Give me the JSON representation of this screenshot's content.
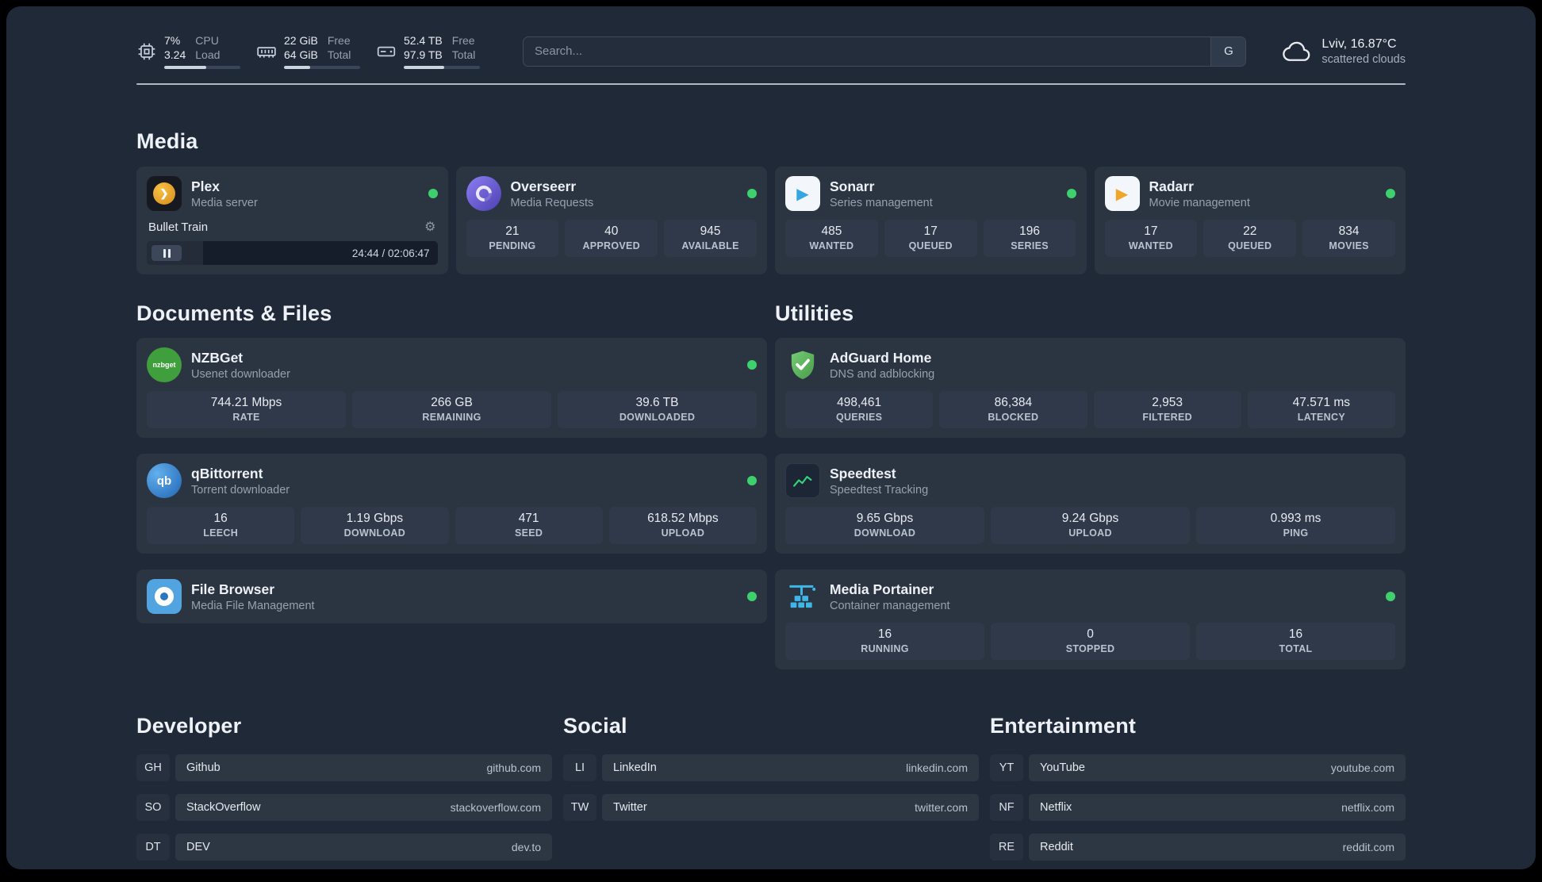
{
  "topbar": {
    "cpu": {
      "v1": "7%",
      "v2": "3.24",
      "l1": "CPU",
      "l2": "Load",
      "bar_percent": 55
    },
    "ram": {
      "v1": "22 GiB",
      "v2": "64 GiB",
      "l1": "Free",
      "l2": "Total",
      "bar_percent": 34
    },
    "disk": {
      "v1": "52.4 TB",
      "v2": "97.9 TB",
      "l1": "Free",
      "l2": "Total",
      "bar_percent": 53
    },
    "search": {
      "placeholder": "Search...",
      "button_label": "G"
    },
    "weather": {
      "location": "Lviv, 16.87°C",
      "condition": "scattered clouds"
    }
  },
  "icons": {
    "gear": "⚙",
    "plex_chevron": "❯",
    "sonarr_play": "▶",
    "radarr_play": "▶",
    "qbittorrent_label": "qb",
    "nzbget_label": "nzbget"
  },
  "sections": {
    "media": {
      "title": "Media"
    },
    "documents": {
      "title": "Documents & Files"
    },
    "utilities": {
      "title": "Utilities"
    },
    "developer": {
      "title": "Developer"
    },
    "social": {
      "title": "Social"
    },
    "entertainment": {
      "title": "Entertainment"
    }
  },
  "apps": {
    "plex": {
      "name": "Plex",
      "subtitle": "Media server",
      "player": {
        "track": "Bullet Train",
        "time": "24:44 / 02:06:47",
        "progress_percent": 19.5
      }
    },
    "overseerr": {
      "name": "Overseerr",
      "subtitle": "Media Requests",
      "stats": [
        {
          "value": "21",
          "label": "PENDING"
        },
        {
          "value": "40",
          "label": "APPROVED"
        },
        {
          "value": "945",
          "label": "AVAILABLE"
        }
      ]
    },
    "sonarr": {
      "name": "Sonarr",
      "subtitle": "Series management",
      "stats": [
        {
          "value": "485",
          "label": "WANTED"
        },
        {
          "value": "17",
          "label": "QUEUED"
        },
        {
          "value": "196",
          "label": "SERIES"
        }
      ]
    },
    "radarr": {
      "name": "Radarr",
      "subtitle": "Movie management",
      "stats": [
        {
          "value": "17",
          "label": "WANTED"
        },
        {
          "value": "22",
          "label": "QUEUED"
        },
        {
          "value": "834",
          "label": "MOVIES"
        }
      ]
    },
    "nzbget": {
      "name": "NZBGet",
      "subtitle": "Usenet downloader",
      "stats": [
        {
          "value": "744.21 Mbps",
          "label": "RATE"
        },
        {
          "value": "266 GB",
          "label": "REMAINING"
        },
        {
          "value": "39.6 TB",
          "label": "DOWNLOADED"
        }
      ]
    },
    "qbittorrent": {
      "name": "qBittorrent",
      "subtitle": "Torrent downloader",
      "stats": [
        {
          "value": "16",
          "label": "LEECH"
        },
        {
          "value": "1.19 Gbps",
          "label": "DOWNLOAD"
        },
        {
          "value": "471",
          "label": "SEED"
        },
        {
          "value": "618.52 Mbps",
          "label": "UPLOAD"
        }
      ]
    },
    "filebrowser": {
      "name": "File Browser",
      "subtitle": "Media File Management"
    },
    "adguard": {
      "name": "AdGuard Home",
      "subtitle": "DNS and adblocking",
      "stats": [
        {
          "value": "498,461",
          "label": "QUERIES"
        },
        {
          "value": "86,384",
          "label": "BLOCKED"
        },
        {
          "value": "2,953",
          "label": "FILTERED"
        },
        {
          "value": "47.571 ms",
          "label": "LATENCY"
        }
      ]
    },
    "speedtest": {
      "name": "Speedtest",
      "subtitle": "Speedtest Tracking",
      "stats": [
        {
          "value": "9.65 Gbps",
          "label": "DOWNLOAD"
        },
        {
          "value": "9.24 Gbps",
          "label": "UPLOAD"
        },
        {
          "value": "0.993 ms",
          "label": "PING"
        }
      ]
    },
    "portainer": {
      "name": "Media Portainer",
      "subtitle": "Container management",
      "stats": [
        {
          "value": "16",
          "label": "RUNNING"
        },
        {
          "value": "0",
          "label": "STOPPED"
        },
        {
          "value": "16",
          "label": "TOTAL"
        }
      ]
    }
  },
  "bookmarks": {
    "developer": [
      {
        "abbr": "GH",
        "name": "Github",
        "domain": "github.com"
      },
      {
        "abbr": "SO",
        "name": "StackOverflow",
        "domain": "stackoverflow.com"
      },
      {
        "abbr": "DT",
        "name": "DEV",
        "domain": "dev.to"
      }
    ],
    "social": [
      {
        "abbr": "LI",
        "name": "LinkedIn",
        "domain": "linkedin.com"
      },
      {
        "abbr": "TW",
        "name": "Twitter",
        "domain": "twitter.com"
      }
    ],
    "entertainment": [
      {
        "abbr": "YT",
        "name": "YouTube",
        "domain": "youtube.com"
      },
      {
        "abbr": "NF",
        "name": "Netflix",
        "domain": "netflix.com"
      },
      {
        "abbr": "RE",
        "name": "Reddit",
        "domain": "reddit.com"
      }
    ]
  },
  "colors": {
    "status_online": "#3ed06c",
    "accent_green": "#34d27b"
  }
}
